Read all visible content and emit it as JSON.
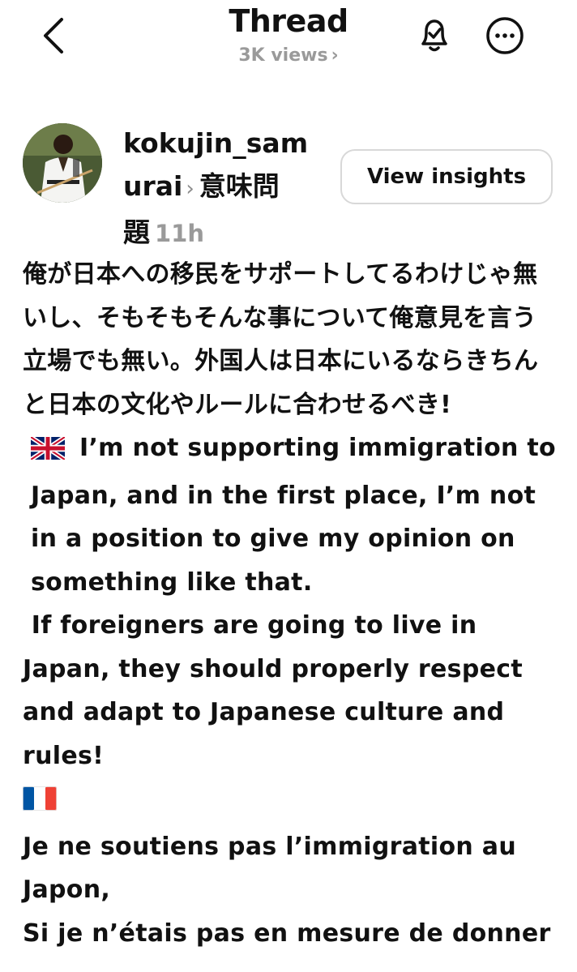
{
  "header": {
    "title": "Thread",
    "views": "3K views",
    "icons": [
      "back-chevron-icon",
      "bell-check-icon",
      "more-icon"
    ]
  },
  "post": {
    "username_line1": "kokujin_sam",
    "username_line2": "urai",
    "topic_line1": "意味問",
    "topic_line2": "題",
    "time": "11h",
    "insights_label": "View insights",
    "body_ja": "俺が日本への移民をサポートしてるわけじゃ無いし、そもそもそんな事について俺意見を言う立場でも無い。外国人は日本にいるならきちんと日本の文化やルールに合わせるべき!",
    "body_en_1": "I’m not supporting immigration to Japan, and in the first place, I’m not in a position to give my opinion on something like that.",
    "body_en_2": " If foreigners are going to live in Japan, they should properly respect and adapt to Japanese culture and rules!",
    "body_fr_1": "Je ne soutiens pas l’immigration au Japon,",
    "body_fr_2_partial": "Si je n’étais pas en mesure de donner mon avis"
  },
  "colors": {
    "text": "#111111",
    "muted": "#9a9a9a",
    "border": "#d8d8d8"
  }
}
